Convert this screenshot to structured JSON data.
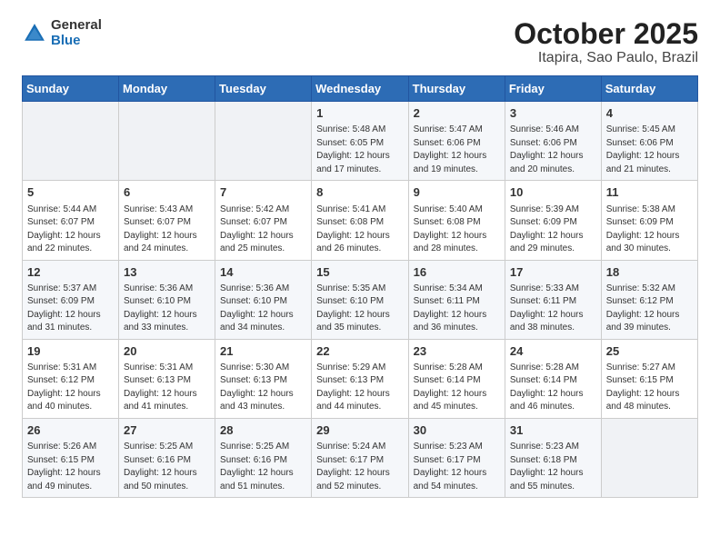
{
  "header": {
    "logo_general": "General",
    "logo_blue": "Blue",
    "month": "October 2025",
    "location": "Itapira, Sao Paulo, Brazil"
  },
  "weekdays": [
    "Sunday",
    "Monday",
    "Tuesday",
    "Wednesday",
    "Thursday",
    "Friday",
    "Saturday"
  ],
  "weeks": [
    [
      {
        "day": "",
        "info": ""
      },
      {
        "day": "",
        "info": ""
      },
      {
        "day": "",
        "info": ""
      },
      {
        "day": "1",
        "info": "Sunrise: 5:48 AM\nSunset: 6:05 PM\nDaylight: 12 hours\nand 17 minutes."
      },
      {
        "day": "2",
        "info": "Sunrise: 5:47 AM\nSunset: 6:06 PM\nDaylight: 12 hours\nand 19 minutes."
      },
      {
        "day": "3",
        "info": "Sunrise: 5:46 AM\nSunset: 6:06 PM\nDaylight: 12 hours\nand 20 minutes."
      },
      {
        "day": "4",
        "info": "Sunrise: 5:45 AM\nSunset: 6:06 PM\nDaylight: 12 hours\nand 21 minutes."
      }
    ],
    [
      {
        "day": "5",
        "info": "Sunrise: 5:44 AM\nSunset: 6:07 PM\nDaylight: 12 hours\nand 22 minutes."
      },
      {
        "day": "6",
        "info": "Sunrise: 5:43 AM\nSunset: 6:07 PM\nDaylight: 12 hours\nand 24 minutes."
      },
      {
        "day": "7",
        "info": "Sunrise: 5:42 AM\nSunset: 6:07 PM\nDaylight: 12 hours\nand 25 minutes."
      },
      {
        "day": "8",
        "info": "Sunrise: 5:41 AM\nSunset: 6:08 PM\nDaylight: 12 hours\nand 26 minutes."
      },
      {
        "day": "9",
        "info": "Sunrise: 5:40 AM\nSunset: 6:08 PM\nDaylight: 12 hours\nand 28 minutes."
      },
      {
        "day": "10",
        "info": "Sunrise: 5:39 AM\nSunset: 6:09 PM\nDaylight: 12 hours\nand 29 minutes."
      },
      {
        "day": "11",
        "info": "Sunrise: 5:38 AM\nSunset: 6:09 PM\nDaylight: 12 hours\nand 30 minutes."
      }
    ],
    [
      {
        "day": "12",
        "info": "Sunrise: 5:37 AM\nSunset: 6:09 PM\nDaylight: 12 hours\nand 31 minutes."
      },
      {
        "day": "13",
        "info": "Sunrise: 5:36 AM\nSunset: 6:10 PM\nDaylight: 12 hours\nand 33 minutes."
      },
      {
        "day": "14",
        "info": "Sunrise: 5:36 AM\nSunset: 6:10 PM\nDaylight: 12 hours\nand 34 minutes."
      },
      {
        "day": "15",
        "info": "Sunrise: 5:35 AM\nSunset: 6:10 PM\nDaylight: 12 hours\nand 35 minutes."
      },
      {
        "day": "16",
        "info": "Sunrise: 5:34 AM\nSunset: 6:11 PM\nDaylight: 12 hours\nand 36 minutes."
      },
      {
        "day": "17",
        "info": "Sunrise: 5:33 AM\nSunset: 6:11 PM\nDaylight: 12 hours\nand 38 minutes."
      },
      {
        "day": "18",
        "info": "Sunrise: 5:32 AM\nSunset: 6:12 PM\nDaylight: 12 hours\nand 39 minutes."
      }
    ],
    [
      {
        "day": "19",
        "info": "Sunrise: 5:31 AM\nSunset: 6:12 PM\nDaylight: 12 hours\nand 40 minutes."
      },
      {
        "day": "20",
        "info": "Sunrise: 5:31 AM\nSunset: 6:13 PM\nDaylight: 12 hours\nand 41 minutes."
      },
      {
        "day": "21",
        "info": "Sunrise: 5:30 AM\nSunset: 6:13 PM\nDaylight: 12 hours\nand 43 minutes."
      },
      {
        "day": "22",
        "info": "Sunrise: 5:29 AM\nSunset: 6:13 PM\nDaylight: 12 hours\nand 44 minutes."
      },
      {
        "day": "23",
        "info": "Sunrise: 5:28 AM\nSunset: 6:14 PM\nDaylight: 12 hours\nand 45 minutes."
      },
      {
        "day": "24",
        "info": "Sunrise: 5:28 AM\nSunset: 6:14 PM\nDaylight: 12 hours\nand 46 minutes."
      },
      {
        "day": "25",
        "info": "Sunrise: 5:27 AM\nSunset: 6:15 PM\nDaylight: 12 hours\nand 48 minutes."
      }
    ],
    [
      {
        "day": "26",
        "info": "Sunrise: 5:26 AM\nSunset: 6:15 PM\nDaylight: 12 hours\nand 49 minutes."
      },
      {
        "day": "27",
        "info": "Sunrise: 5:25 AM\nSunset: 6:16 PM\nDaylight: 12 hours\nand 50 minutes."
      },
      {
        "day": "28",
        "info": "Sunrise: 5:25 AM\nSunset: 6:16 PM\nDaylight: 12 hours\nand 51 minutes."
      },
      {
        "day": "29",
        "info": "Sunrise: 5:24 AM\nSunset: 6:17 PM\nDaylight: 12 hours\nand 52 minutes."
      },
      {
        "day": "30",
        "info": "Sunrise: 5:23 AM\nSunset: 6:17 PM\nDaylight: 12 hours\nand 54 minutes."
      },
      {
        "day": "31",
        "info": "Sunrise: 5:23 AM\nSunset: 6:18 PM\nDaylight: 12 hours\nand 55 minutes."
      },
      {
        "day": "",
        "info": ""
      }
    ]
  ]
}
